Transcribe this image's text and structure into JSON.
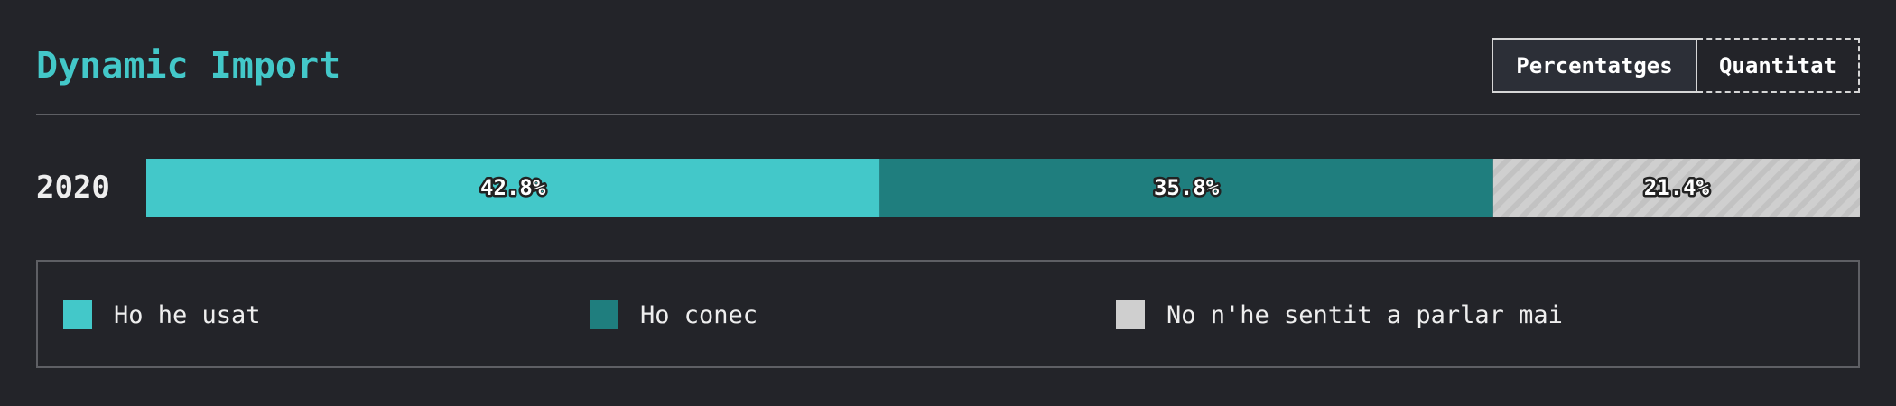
{
  "header": {
    "title": "Dynamic Import",
    "toggle": {
      "percentages_label": "Percentatges",
      "quantity_label": "Quantitat",
      "active": "percentages"
    }
  },
  "colors": {
    "background": "#232429",
    "accent": "#43c8c9",
    "series": [
      "#43c8c9",
      "#1f7e7e",
      "#cfcfcf"
    ]
  },
  "chart_data": {
    "type": "bar",
    "orientation": "horizontal",
    "stacked": true,
    "normalized": true,
    "categories": [
      "2020"
    ],
    "series": [
      {
        "name": "Ho he usat",
        "values": [
          42.8
        ],
        "label": "42.8%",
        "color": "#43c8c9",
        "pattern": "solid"
      },
      {
        "name": "Ho conec",
        "values": [
          35.8
        ],
        "label": "35.8%",
        "color": "#1f7e7e",
        "pattern": "solid"
      },
      {
        "name": "No n'he sentit a parlar mai",
        "values": [
          21.4
        ],
        "label": "21.4%",
        "color": "#cfcfcf",
        "pattern": "diagonal-stripes"
      }
    ],
    "xlim": [
      0,
      100
    ],
    "unit": "%",
    "legend_position": "bottom",
    "grid": false
  }
}
